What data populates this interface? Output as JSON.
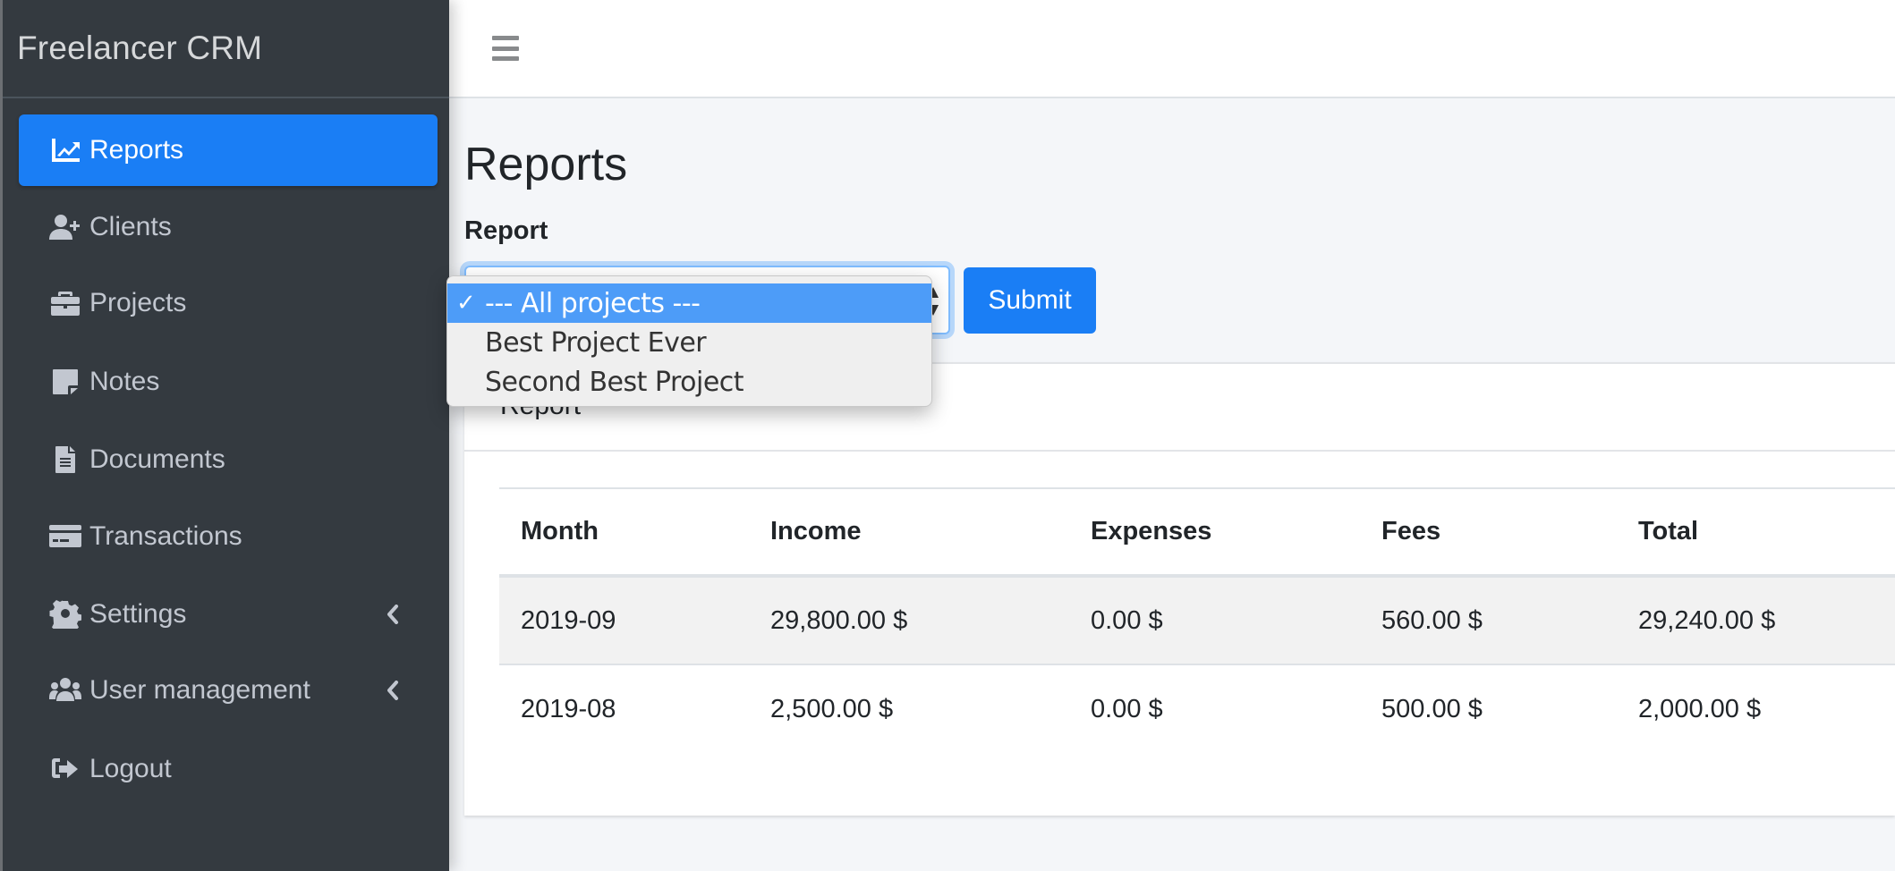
{
  "app": {
    "brand": "Freelancer CRM"
  },
  "sidebar": {
    "items": [
      {
        "label": "Reports",
        "icon": "chart-line-icon",
        "active": true,
        "has_submenu": false
      },
      {
        "label": "Clients",
        "icon": "user-plus-icon",
        "active": false,
        "has_submenu": false
      },
      {
        "label": "Projects",
        "icon": "briefcase-icon",
        "active": false,
        "has_submenu": false
      },
      {
        "label": "Notes",
        "icon": "sticky-note-icon",
        "active": false,
        "has_submenu": false
      },
      {
        "label": "Documents",
        "icon": "file-alt-icon",
        "active": false,
        "has_submenu": false
      },
      {
        "label": "Transactions",
        "icon": "credit-card-icon",
        "active": false,
        "has_submenu": false
      },
      {
        "label": "Settings",
        "icon": "cog-icon",
        "active": false,
        "has_submenu": true
      },
      {
        "label": "User management",
        "icon": "users-icon",
        "active": false,
        "has_submenu": true
      },
      {
        "label": "Logout",
        "icon": "sign-out-icon",
        "active": false,
        "has_submenu": false
      }
    ]
  },
  "header": {
    "menu_icon": "hamburger-icon"
  },
  "main": {
    "title": "Reports",
    "form": {
      "label": "Report",
      "select": {
        "value": "--- All projects ---",
        "options": [
          "--- All projects ---",
          "Best Project Ever",
          "Second Best Project"
        ],
        "selected_index": 0,
        "check_mark": "✓"
      },
      "submit_label": "Submit"
    },
    "card": {
      "title": "Report",
      "table": {
        "columns": [
          "Month",
          "Income",
          "Expenses",
          "Fees",
          "Total"
        ],
        "rows": [
          [
            "2019-09",
            "29,800.00 $",
            "0.00 $",
            "560.00 $",
            "29,240.00 $"
          ],
          [
            "2019-08",
            "2,500.00 $",
            "0.00 $",
            "500.00 $",
            "2,000.00 $"
          ]
        ]
      }
    }
  },
  "colors": {
    "sidebar_bg": "#343a40",
    "accent": "#1a7ef5",
    "dropdown_highlight": "#4d9cf8",
    "content_bg": "#f4f6f9"
  }
}
